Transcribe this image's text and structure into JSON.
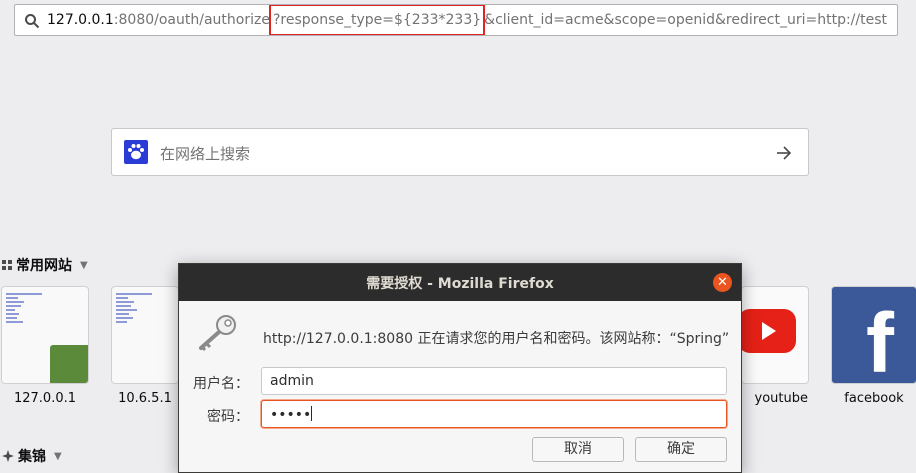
{
  "urlbar": {
    "host": "127.0.0.1",
    "path": ":8080/oauth/authorize",
    "highlight": "?response_type=${233*233}",
    "tail": "&client_id=acme&scope=openid&redirect_uri=http://test",
    "highlight_color": "#e02424"
  },
  "search": {
    "placeholder": "在网络上搜索",
    "engine_icon": "baidu-paw-icon"
  },
  "sections": {
    "top_sites": "常用网站",
    "highlights": "集锦"
  },
  "tiles": [
    {
      "label": "127.0.0.1"
    },
    {
      "label": "10.6.5.1"
    },
    {
      "label": "youtube"
    },
    {
      "label": "facebook"
    }
  ],
  "dialog": {
    "title": "需要授权 - Mozilla Firefox",
    "message": "http://127.0.0.1:8080 正在请求您的用户名和密码。该网站称：“Spring”",
    "username_label": "用户名：",
    "username_value": "admin",
    "password_label": "密码：",
    "password_value": "•••••",
    "cancel_label": "取消",
    "ok_label": "确定",
    "close_glyph": "✕",
    "accent": "#e95420"
  }
}
